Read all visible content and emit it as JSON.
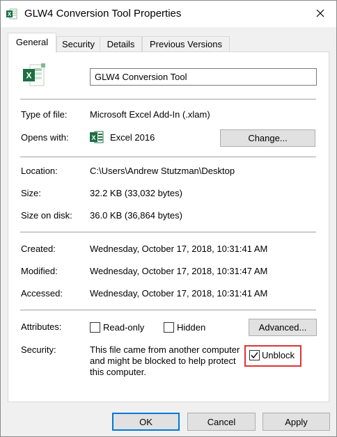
{
  "window": {
    "title": "GLW4 Conversion Tool Properties"
  },
  "tabs": [
    {
      "label": "General",
      "active": true
    },
    {
      "label": "Security",
      "active": false
    },
    {
      "label": "Details",
      "active": false
    },
    {
      "label": "Previous Versions",
      "active": false
    }
  ],
  "general": {
    "file_name": "GLW4 Conversion Tool",
    "type_label": "Type of file:",
    "type_value": "Microsoft Excel Add-In (.xlam)",
    "opens_label": "Opens with:",
    "opens_value": "Excel 2016",
    "change_button": "Change...",
    "location_label": "Location:",
    "location_value": "C:\\Users\\Andrew Stutzman\\Desktop",
    "size_label": "Size:",
    "size_value": "32.2 KB (33,032 bytes)",
    "size_on_disk_label": "Size on disk:",
    "size_on_disk_value": "36.0 KB (36,864 bytes)",
    "created_label": "Created:",
    "created_value": "Wednesday, October 17, 2018, 10:31:41 AM",
    "modified_label": "Modified:",
    "modified_value": "Wednesday, October 17, 2018, 10:31:47 AM",
    "accessed_label": "Accessed:",
    "accessed_value": "Wednesday, October 17, 2018, 10:31:41 AM",
    "attributes_label": "Attributes:",
    "readonly_label": "Read-only",
    "readonly_checked": false,
    "hidden_label": "Hidden",
    "hidden_checked": false,
    "advanced_button": "Advanced...",
    "security_label": "Security:",
    "security_text": "This file came from another computer and might be blocked to help protect this computer.",
    "unblock_label": "Unblock",
    "unblock_checked": true
  },
  "footer": {
    "ok": "OK",
    "cancel": "Cancel",
    "apply": "Apply"
  },
  "colors": {
    "excel_green": "#1d6f42",
    "highlight_red": "#dd3333",
    "focus_blue": "#0078d7"
  },
  "icons": {
    "title": "excel-file-icon",
    "close": "close-icon",
    "file": "excel-addin-file-icon",
    "opens_with": "excel-app-icon",
    "checkmark": "checkmark-icon"
  }
}
